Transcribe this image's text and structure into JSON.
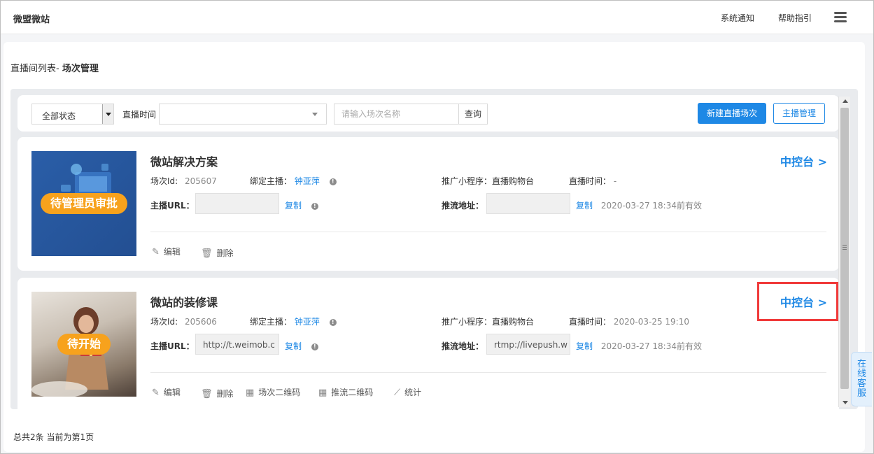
{
  "header": {
    "brand": "微盟微站",
    "links": [
      "系统通知",
      "帮助指引"
    ],
    "menu_icon": "hamburger-menu-icon"
  },
  "breadcrumb": {
    "parent": "直播间列表-",
    "current": "场次管理"
  },
  "filters": {
    "status_select": "全部状态",
    "time_label": "直播时间",
    "time_value": "",
    "search_placeholder": "请输入场次名称",
    "search_button": "查询",
    "new_button": "新建直播场次",
    "host_button": "主播管理"
  },
  "sessions": [
    {
      "title": "微站解决方案",
      "status": "待管理员审批",
      "console": "中控台 >",
      "id_label": "场次Id:",
      "id": "205607",
      "host_label": "绑定主播：",
      "host": "钟亚萍",
      "program_label": "推广小程序：",
      "program": "直播购物台",
      "time_label": "直播时间：",
      "time": "-",
      "url_label": "主播URL：",
      "url_value": "",
      "copy": "复制",
      "push_label": "推流地址：",
      "push_value": "",
      "expiry": "2020-03-27 18:34前有效",
      "actions": [
        "编辑",
        "删除"
      ]
    },
    {
      "title": "微站的装修课",
      "status": "待开始",
      "console": "中控台 >",
      "id_label": "场次Id:",
      "id": "205606",
      "host_label": "绑定主播：",
      "host": "钟亚萍",
      "program_label": "推广小程序：",
      "program": "直播购物台",
      "time_label": "直播时间：",
      "time": "2020-03-25 19:10",
      "url_label": "主播URL：",
      "url_value": "http://t.weimob.c",
      "copy": "复制",
      "push_label": "推流地址：",
      "push_value": "rtmp://livepush.w",
      "expiry": "2020-03-27 18:34前有效",
      "actions": [
        "编辑",
        "删除",
        "场次二维码",
        "推流二维码",
        "统计"
      ]
    }
  ],
  "footer": {
    "summary": "总共2条 当前为第1页"
  },
  "chat_tab": "在线客服",
  "colors": {
    "accent": "#1e88e5",
    "status_pill": "#f7a21d",
    "highlight": "#f03a3a"
  }
}
